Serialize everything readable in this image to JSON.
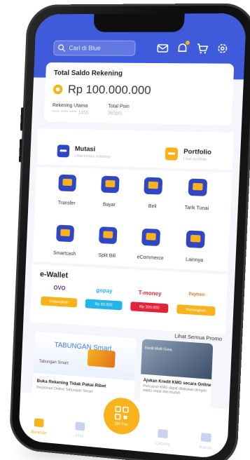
{
  "colors": {
    "brand_blue": "#3f5bdc",
    "icon_blue": "#2f47c6",
    "accent_yellow": "#f7b21c",
    "gopay_blue": "#23b5e8",
    "tmoney_red": "#e2233a",
    "ovo_purple": "#4c3494"
  },
  "header": {
    "search_placeholder": "Cari di Blue",
    "icons": [
      "mail-icon",
      "bell-icon",
      "cart-icon",
      "settings-icon"
    ]
  },
  "balance": {
    "title": "Total Saldo Rekening",
    "amount": "Rp 100.000.000",
    "account_label": "Rekening Utama",
    "account_value": "**** **** **** 1455",
    "points_label": "Total Poin",
    "points_value": "365pts"
  },
  "quick": [
    {
      "label": "Mutasi",
      "sub": "Lihat mutasi rekening"
    },
    {
      "label": "Portfolio",
      "sub": "Lihat portfolio"
    }
  ],
  "menu": [
    {
      "label": "Transfer",
      "icon": "transfer-icon"
    },
    {
      "label": "Bayar",
      "icon": "pay-icon"
    },
    {
      "label": "Beli",
      "icon": "buy-icon"
    },
    {
      "label": "Tarik Tunai",
      "icon": "cash-withdraw-icon"
    },
    {
      "label": "Smartcash",
      "icon": "smartcash-icon"
    },
    {
      "label": "Split Bill",
      "icon": "split-bill-icon"
    },
    {
      "label": "eCommerce",
      "icon": "ecommerce-icon"
    },
    {
      "label": "Lainnya",
      "icon": "more-icon"
    }
  ],
  "ewallet": {
    "title": "e-Wallet",
    "items": [
      {
        "name": "OVO",
        "pill": "Hubungkan"
      },
      {
        "name": "gopay",
        "pill": "Rp 83.500"
      },
      {
        "name": "T-money",
        "pill": "Rp 200.000"
      },
      {
        "name": "Paytren",
        "pill": "Hubungkan"
      }
    ]
  },
  "promo": {
    "see_all": "Lihat Semua Promo",
    "main_brand": "TABUNGAN Smart",
    "main_brand_small": "Tabungan Smart",
    "main_title": "Buka Rekening Tidak Pakai Ribet",
    "main_sub": "Registrasi Online Tabungan Smart",
    "side_tag": "Kredit Multi Guna",
    "side_title": "Ajukan Kredit KMG secara Online",
    "side_sub": "Pencairan KMG dapat dilakukan dengan waktu cepat dan mudah"
  },
  "nav": [
    {
      "label": "Beranda",
      "icon": "home-icon",
      "active": true
    },
    {
      "label": "ATM",
      "icon": "atm-icon",
      "active": false
    },
    {
      "label": "QR Pay",
      "icon": "qr-icon",
      "active": false
    },
    {
      "label": "Cabang",
      "icon": "branch-icon",
      "active": false
    },
    {
      "label": "Keluar",
      "icon": "logout-icon",
      "active": false
    }
  ]
}
